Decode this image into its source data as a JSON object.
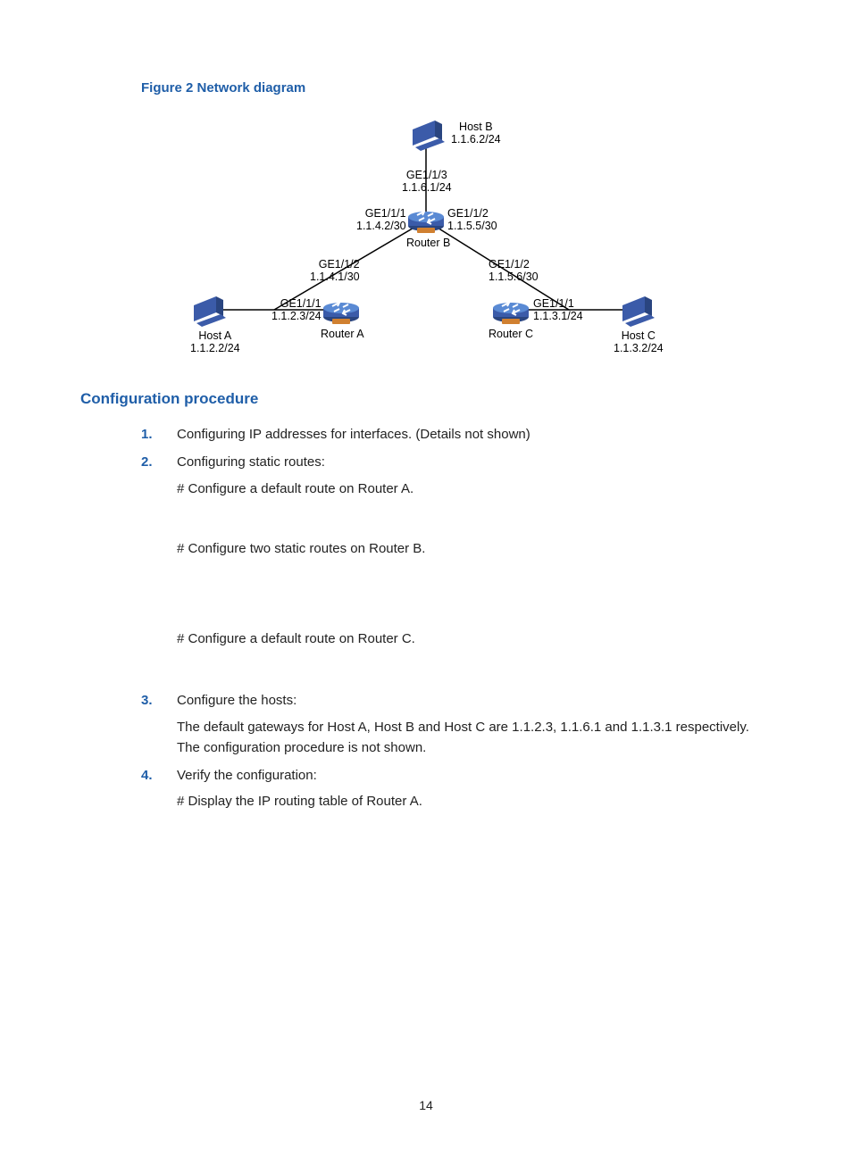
{
  "figure_caption": "Figure 2 Network diagram",
  "diagram": {
    "host_b": {
      "name": "Host B",
      "ip": "1.1.6.2/24"
    },
    "router_b": {
      "name": "Router B",
      "if_top": {
        "port": "GE1/1/3",
        "ip": "1.1.6.1/24"
      },
      "if_left": {
        "port": "GE1/1/1",
        "ip": "1.1.4.2/30"
      },
      "if_right": {
        "port": "GE1/1/2",
        "ip": "1.1.5.5/30"
      }
    },
    "router_a": {
      "name": "Router A",
      "if_up": {
        "port": "GE1/1/2",
        "ip": "1.1.4.1/30"
      },
      "if_left": {
        "port": "GE1/1/1",
        "ip": "1.1.2.3/24"
      }
    },
    "router_c": {
      "name": "Router C",
      "if_up": {
        "port": "GE1/1/2",
        "ip": "1.1.5.6/30"
      },
      "if_right": {
        "port": "GE1/1/1",
        "ip": "1.1.3.1/24"
      }
    },
    "host_a": {
      "name": "Host A",
      "ip": "1.1.2.2/24"
    },
    "host_c": {
      "name": "Host C",
      "ip": "1.1.3.2/24"
    }
  },
  "section_heading": "Configuration procedure",
  "steps": {
    "s1": {
      "num": "1.",
      "text": "Configuring IP addresses for interfaces. (Details not shown)"
    },
    "s2": {
      "num": "2.",
      "text": "Configuring static routes:",
      "sub1": "# Configure a default route on Router A.",
      "sub2": "# Configure two static routes on Router B.",
      "sub3": "# Configure a default route on Router C."
    },
    "s3": {
      "num": "3.",
      "text": "Configure the hosts:",
      "sub1": "The default gateways for Host A, Host B and Host C are 1.1.2.3, 1.1.6.1 and 1.1.3.1 respectively. The configuration procedure is not shown."
    },
    "s4": {
      "num": "4.",
      "text": "Verify the configuration:",
      "sub1": "# Display the IP routing table of Router A."
    }
  },
  "page_number": "14"
}
